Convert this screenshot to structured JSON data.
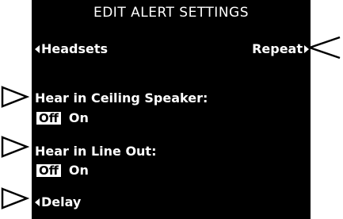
{
  "screen": {
    "title": "EDIT ALERT SETTINGS",
    "nav_left_label": "Headsets",
    "nav_right_label": "Repeat",
    "nav_bottom_label": "Delay",
    "settings": [
      {
        "label": "Hear in Ceiling Speaker:",
        "options": [
          "Off",
          "On"
        ],
        "selected": "Off"
      },
      {
        "label": "Hear in Line Out:",
        "options": [
          "Off",
          "On"
        ],
        "selected": "Off"
      }
    ]
  },
  "colors": {
    "screen_background": "#000000",
    "screen_text": "#ffffff",
    "selected_option_background": "#ffffff",
    "selected_option_text": "#000000",
    "page_background": "#ffffff"
  },
  "icons": {
    "nav_left": "triangle-left-icon",
    "nav_right": "triangle-right-icon",
    "pointer": "outlined-triangle-pointer-icon"
  }
}
